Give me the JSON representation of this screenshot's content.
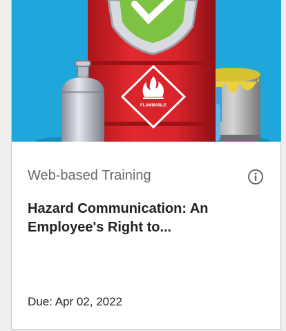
{
  "card": {
    "image": {
      "icon": "training-thumbnail-hazardous-barrels",
      "drum_label": "FLAMMABLE"
    },
    "type": "Web-based Training",
    "info_icon": "info-circle-icon",
    "title": "Hazard Communication: An Employee's Right to...",
    "due": "Due: Apr 02, 2022"
  },
  "colors": {
    "image_background": "#1fa7dc",
    "drum_red": "#d8242a",
    "shield_green": "#7dc242",
    "text_dark": "#222222",
    "text_muted": "#666666"
  }
}
